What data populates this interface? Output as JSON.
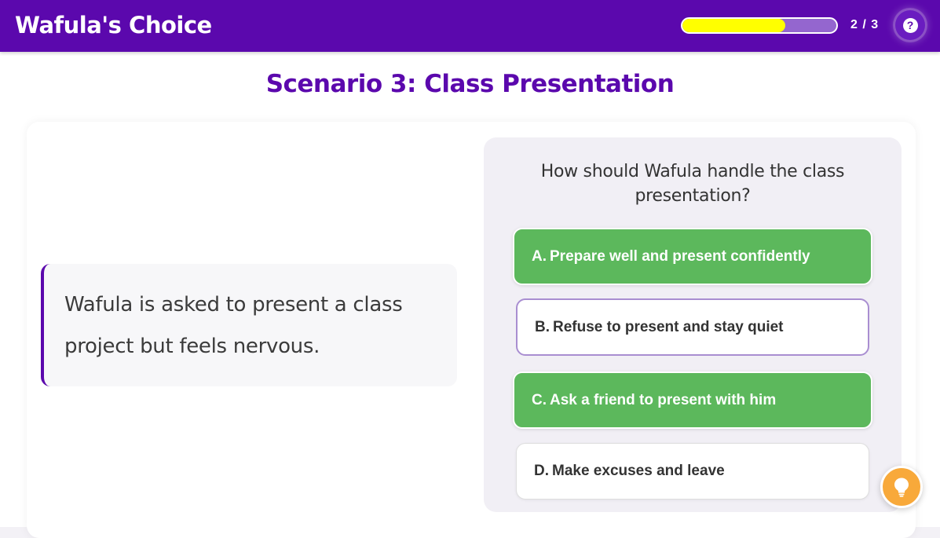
{
  "header": {
    "title": "Wafula's Choice",
    "progress_fraction": 0.67,
    "progress_text": "2 / 3",
    "help_label": "?"
  },
  "scenario": {
    "title": "Scenario 3: Class Presentation",
    "story": "Wafula is asked to present a class project but feels nervous."
  },
  "question": {
    "text": "How should Wafula handle the class presentation?",
    "options": [
      {
        "letter": "A.",
        "label": "Prepare well and present confidently",
        "state": "selected"
      },
      {
        "letter": "B.",
        "label": "Refuse to present and stay quiet",
        "state": "unselected"
      },
      {
        "letter": "C.",
        "label": "Ask a friend to present with him",
        "state": "selected"
      },
      {
        "letter": "D.",
        "label": "Make excuses and leave",
        "state": "unselected"
      }
    ]
  },
  "hint": {
    "icon": "lightbulb-icon"
  },
  "colors": {
    "brand_purple": "#5b08ad",
    "progress_yellow": "#ffff00",
    "correct_green": "#5cb85c",
    "hint_orange": "#f8a93a"
  }
}
